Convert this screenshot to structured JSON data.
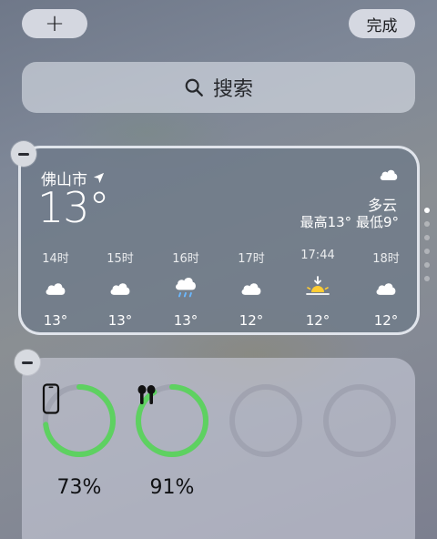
{
  "top_bar": {
    "add_label": "+",
    "done_label": "完成"
  },
  "search": {
    "label": "搜索",
    "icon": "search-icon"
  },
  "weather": {
    "city": "佛山市",
    "location_icon": "location-arrow-icon",
    "temperature": "13°",
    "condition": "多云",
    "high_low": "最高13° 最低9°",
    "hourly": [
      {
        "time": "14时",
        "icon": "cloud-icon",
        "temp": "13°"
      },
      {
        "time": "15时",
        "icon": "cloud-icon",
        "temp": "13°"
      },
      {
        "time": "16时",
        "icon": "cloud-rain-icon",
        "temp": "13°"
      },
      {
        "time": "17时",
        "icon": "cloud-icon",
        "temp": "12°"
      },
      {
        "time": "17:44",
        "icon": "sunset-icon",
        "temp": "12°"
      },
      {
        "time": "18时",
        "icon": "cloud-icon",
        "temp": "12°"
      }
    ]
  },
  "batteries": {
    "accent_color": "#5ed161",
    "items": [
      {
        "device": "phone-icon",
        "level": 73,
        "label": "73%"
      },
      {
        "device": "airpods-icon",
        "level": 91,
        "label": "91%"
      },
      {
        "device": "",
        "level": 0,
        "label": ""
      },
      {
        "device": "",
        "level": 0,
        "label": ""
      }
    ]
  },
  "page_indicator": {
    "count": 6,
    "active": 0
  }
}
